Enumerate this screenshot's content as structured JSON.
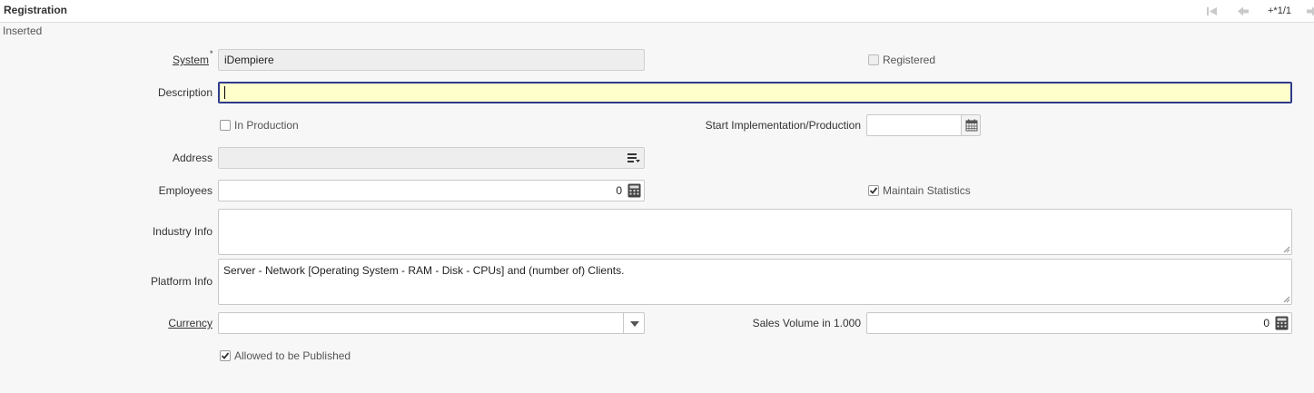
{
  "window": {
    "title": "Registration"
  },
  "toolbar": {
    "record_count": "+*1/1"
  },
  "status": {
    "text": "Inserted"
  },
  "fields": {
    "system": {
      "label": "System",
      "value": "iDempiere",
      "required_mark": "*"
    },
    "registered": {
      "label": "Registered",
      "checked": false
    },
    "description": {
      "label": "Description",
      "value": ""
    },
    "in_production": {
      "label": "In Production",
      "checked": false
    },
    "start_implementation": {
      "label": "Start Implementation/Production",
      "value": ""
    },
    "address": {
      "label": "Address",
      "value": ""
    },
    "employees": {
      "label": "Employees",
      "value": "0"
    },
    "maintain_statistics": {
      "label": "Maintain Statistics",
      "checked": true
    },
    "industry_info": {
      "label": "Industry Info",
      "value": ""
    },
    "platform_info": {
      "label": "Platform Info",
      "value": "Server - Network [Operating System - RAM - Disk - CPUs] and (number of) Clients."
    },
    "currency": {
      "label": "Currency",
      "value": ""
    },
    "sales_volume": {
      "label": "Sales Volume in 1.000",
      "value": "0"
    },
    "allowed_published": {
      "label": "Allowed to be Published",
      "checked": true
    }
  },
  "icons": {
    "first": "first-record-icon",
    "prev": "previous-record-icon",
    "next": "next-record-icon",
    "calendar": "calendar-icon",
    "address": "location-icon",
    "calculator": "calculator-icon",
    "dropdown": "chevron-down-icon"
  },
  "colors": {
    "focus_bg": "#ffffcc",
    "focus_border": "#2d3a8c"
  }
}
